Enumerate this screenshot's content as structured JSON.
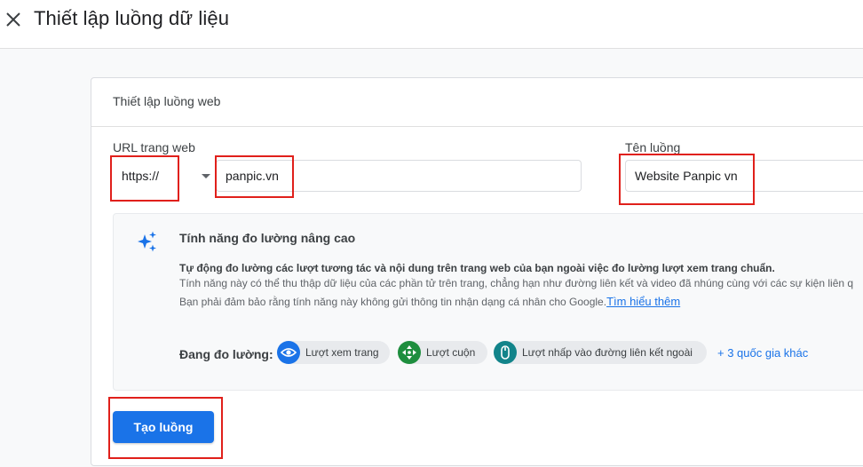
{
  "header": {
    "title": "Thiết lập luồng dữ liệu",
    "close_icon": "close-icon"
  },
  "card": {
    "title": "Thiết lập luồng web",
    "url_label": "URL trang web",
    "protocol_value": "https://",
    "url_value": "panpic.vn",
    "stream_name_label": "Tên luồng",
    "stream_name_value": "Website Panpic vn"
  },
  "enhanced": {
    "icon": "sparkle-icon",
    "title": "Tính năng đo lường nâng cao",
    "desc_bold": "Tự động đo lường các lượt tương tác và nội dung trên trang web của bạn ngoài việc đo lường lượt xem trang chuẩn.",
    "desc_line2": "Tính năng này có thể thu thập dữ liệu của các phần tử trên trang, chẳng hạn như đường liên kết và video đã nhúng cùng với các sự kiện liên q",
    "desc_line3": "Bạn phải đảm bảo rằng tính năng này không gửi thông tin nhận dạng cá nhân cho Google.",
    "learn_more": "Tìm hiểu thêm",
    "measuring_label": "Đang đo lường:",
    "chips": [
      {
        "label": "Lượt xem trang",
        "icon": "eye-icon",
        "color": "#1a73e8"
      },
      {
        "label": "Lượt cuộn",
        "icon": "scroll-icon",
        "color": "#1e8e3e"
      },
      {
        "label": "Lượt nhấp vào đường liên kết ngoài",
        "icon": "mouse-icon",
        "color": "#12848a"
      }
    ],
    "more": "+ 3 quốc gia khác"
  },
  "actions": {
    "create_label": "Tạo luồng"
  },
  "colors": {
    "accent": "#1a73e8",
    "highlight": "#e0201b"
  }
}
